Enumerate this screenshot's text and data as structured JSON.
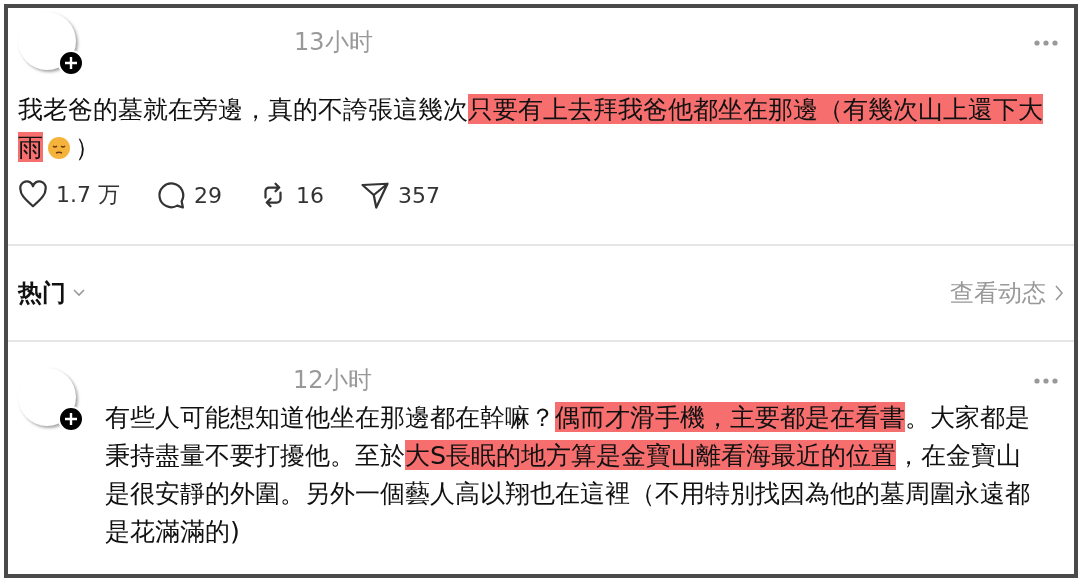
{
  "posts": [
    {
      "time": "13小时",
      "text": [
        {
          "text": "我老爸的墓就在旁邊，真的不誇張這幾次",
          "highlight": false
        },
        {
          "text": "只要有上去拜我爸他都坐在那邊（有幾次山上還下大雨",
          "highlight": true
        },
        {
          "kind": "emoji"
        },
        {
          "text": "）",
          "highlight": false
        }
      ],
      "actions": [
        {
          "kind": "like",
          "count": "1.7 万"
        },
        {
          "kind": "comment",
          "count": "29"
        },
        {
          "kind": "repost",
          "count": "16"
        },
        {
          "kind": "share",
          "count": "357"
        }
      ]
    },
    {
      "time": "12小时",
      "text": [
        {
          "text": "有些人可能想知道他坐在那邊都在幹嘛？",
          "highlight": false
        },
        {
          "text": "偶而才滑手機，主要都是在看書",
          "highlight": true
        },
        {
          "text": "。大家都是秉持盡量不要打擾他。至於",
          "highlight": false
        },
        {
          "text": "大S長眠的地方算是金寶山離看海最近的位置",
          "highlight": true
        },
        {
          "text": "，在金寶山是很安靜的外圍。另外一個藝人高以翔也在這裡（不用特別找因為他的墓周圍永遠都是花滿滿的)",
          "highlight": false
        }
      ]
    }
  ],
  "section": {
    "sort": "热门",
    "link": "查看动态"
  }
}
